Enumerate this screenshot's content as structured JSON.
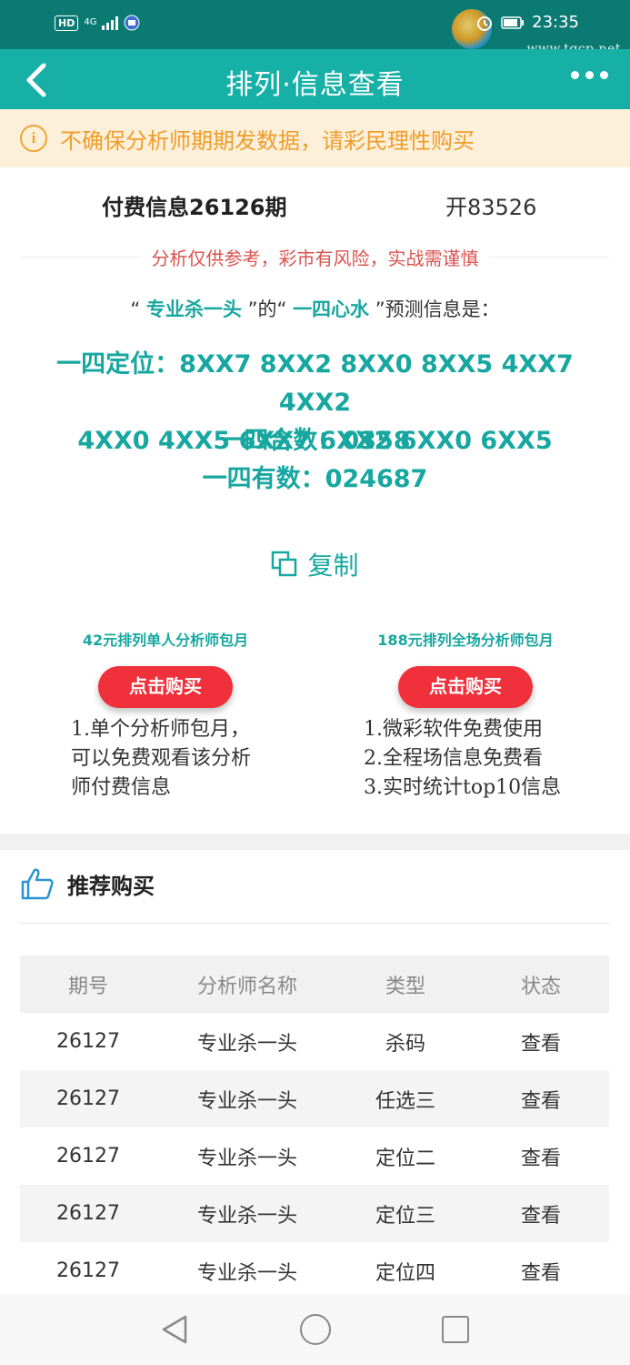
{
  "status_bar": {
    "hd": "HD",
    "network": "4G",
    "time": "23:35",
    "watermark": "www.tqcp.net"
  },
  "nav": {
    "title": "排列·信息查看"
  },
  "notice": {
    "icon_text": "i",
    "text": "不确保分析师期期发数据，请彩民理性购买"
  },
  "info": {
    "title": "付费信息26126期",
    "open": "开83526",
    "risk": "分析仅供参考，彩市有风险，实战需谨慎",
    "predict_prefix": "“",
    "analyst": "专业杀一头",
    "predict_mid": "”的“",
    "category": "一四心水",
    "predict_suffix": "”预测信息是：",
    "dingwei_label": "一四定位：",
    "dingwei_line1": "8XX7 8XX2 8XX0 8XX5 4XX7 4XX2",
    "dingwei_line2": "4XX0 4XX5 6XX7 6XX2 6XX0 6XX5",
    "heshu_label": "一四合数：",
    "heshu_value": "0358",
    "youshu_label": "一四有数：",
    "youshu_value": "024687"
  },
  "copy": {
    "label": "复制"
  },
  "packages": [
    {
      "title": "42元排列单人分析师包月",
      "button": "点击购买",
      "lines": [
        "1.单个分析师包月，",
        "可以免费观看该分析",
        "师付费信息"
      ]
    },
    {
      "title": "188元排列全场分析师包月",
      "button": "点击购买",
      "lines": [
        "1.微彩软件免费使用",
        "2.全程场信息免费看",
        "3.实时统计top10信息"
      ]
    }
  ],
  "recommend": {
    "title": "推荐购买",
    "headers": [
      "期号",
      "分析师名称",
      "类型",
      "状态"
    ],
    "rows": [
      {
        "issue": "26127",
        "analyst": "专业杀一头",
        "type": "杀码",
        "status": "查看"
      },
      {
        "issue": "26127",
        "analyst": "专业杀一头",
        "type": "任选三",
        "status": "查看"
      },
      {
        "issue": "26127",
        "analyst": "专业杀一头",
        "type": "定位二",
        "status": "查看"
      },
      {
        "issue": "26127",
        "analyst": "专业杀一头",
        "type": "定位三",
        "status": "查看"
      },
      {
        "issue": "26127",
        "analyst": "专业杀一头",
        "type": "定位四",
        "status": "查看"
      }
    ]
  },
  "colors": {
    "status_bar": "#0b7a73",
    "nav_bar": "#17b0a7",
    "accent_teal": "#17a7a0",
    "buy_red": "#f0303a",
    "risk_red": "#d9534f",
    "notice_bg": "#fdf0da",
    "notice_text": "#ef9d2b"
  },
  "icons": {
    "back": "chevron-left-icon",
    "more": "more-dots-icon",
    "notice": "info-circle-icon",
    "copy": "copy-icon",
    "recommend": "thumbs-up-icon",
    "nav_back": "triangle-back-icon",
    "nav_home": "circle-home-icon",
    "nav_recent": "square-recent-icon"
  }
}
